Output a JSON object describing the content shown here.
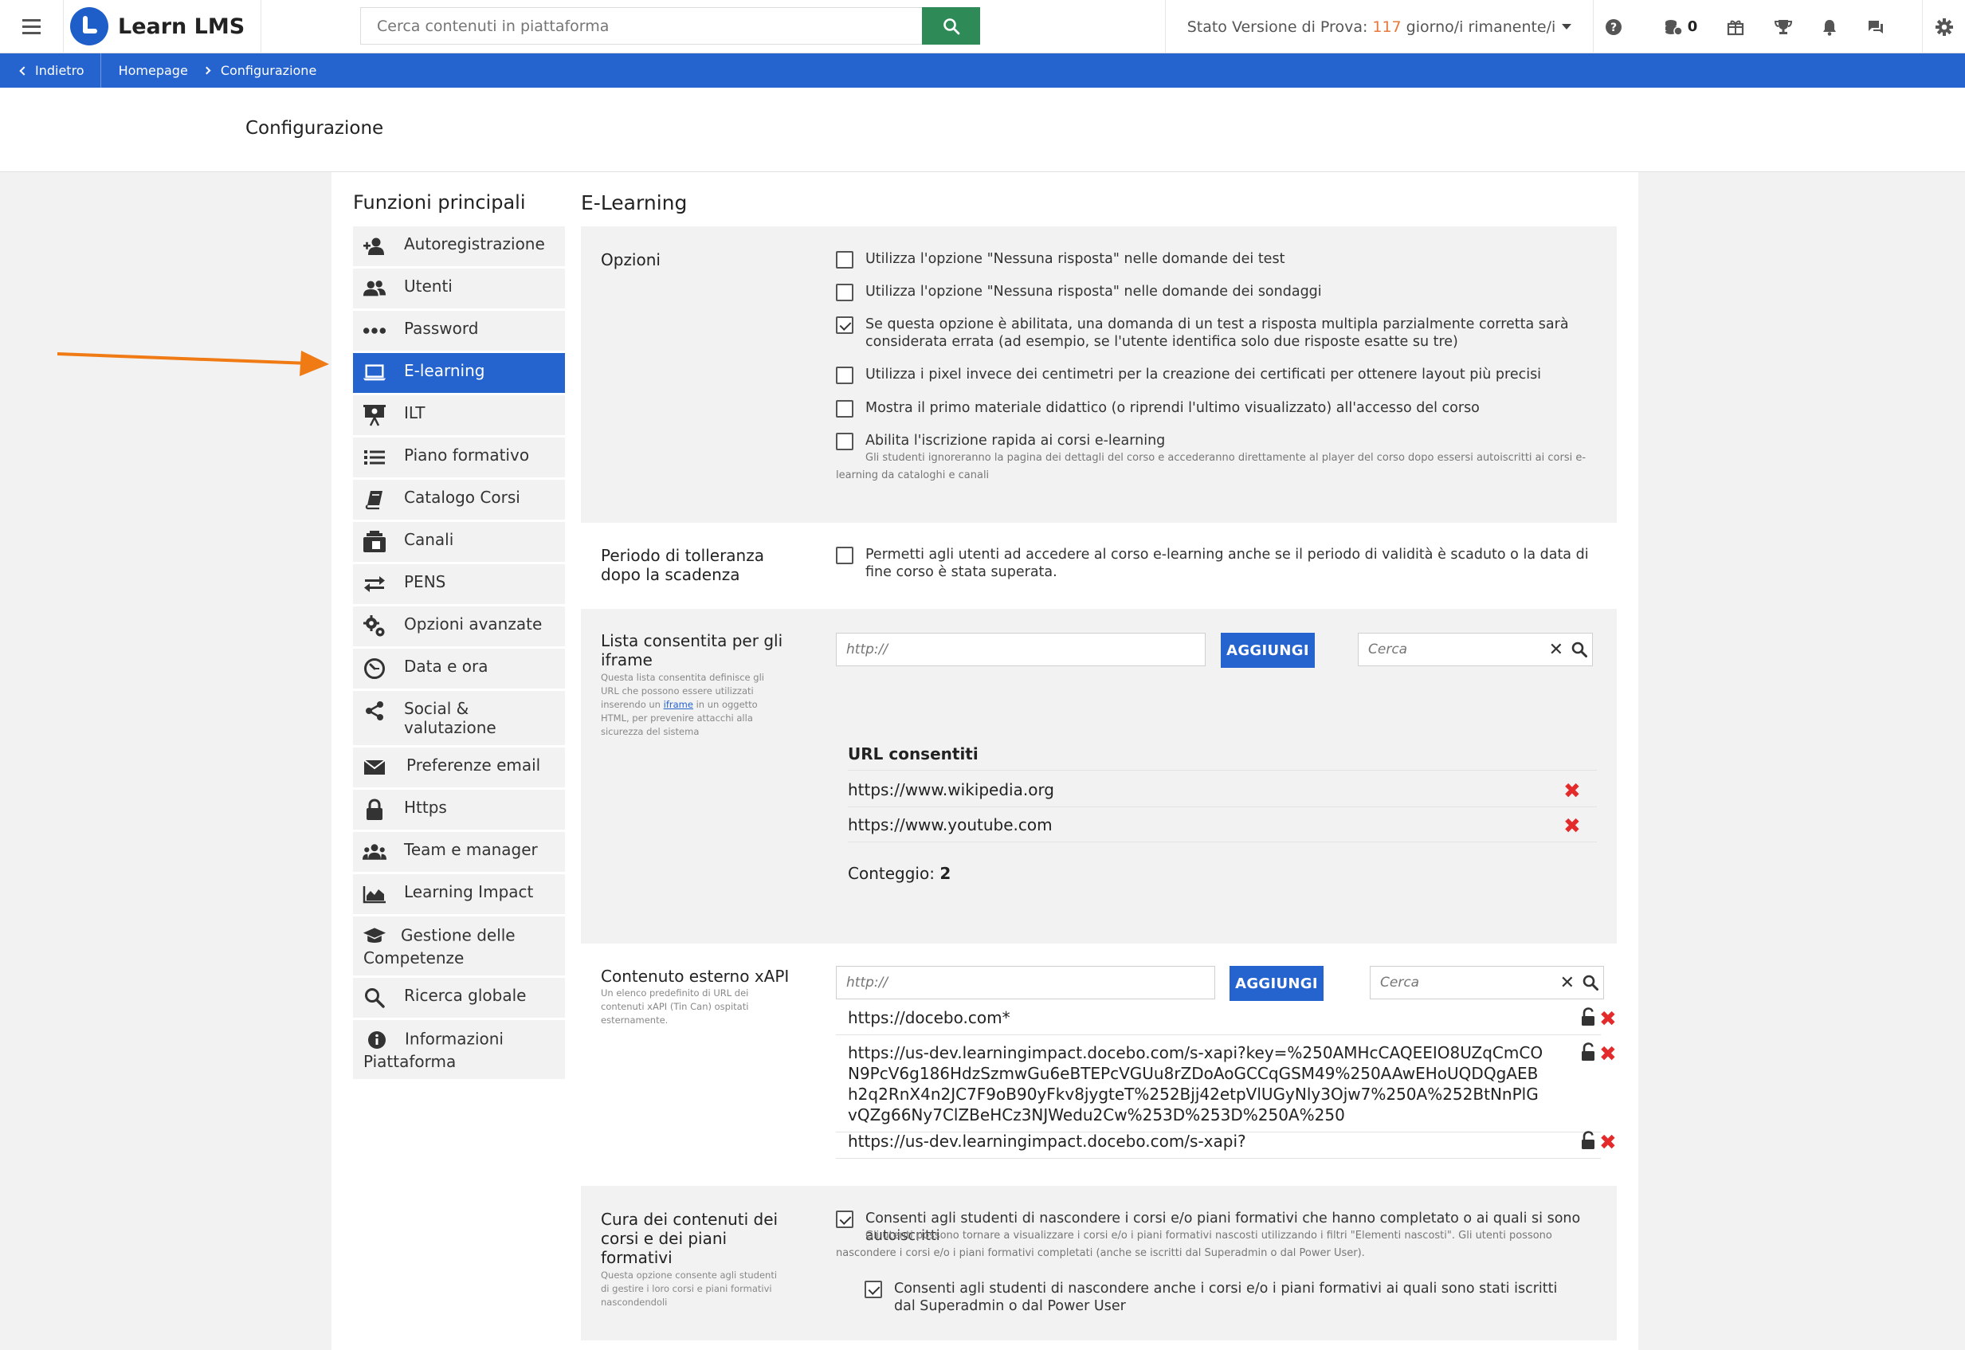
{
  "header": {
    "brand": "Learn LMS",
    "search_placeholder": "Cerca contenuti in piattaforma",
    "trial_prefix": "Stato Versione di Prova:",
    "trial_days": "117",
    "trial_suffix": "giorno/i rimanente/i",
    "credits_count": "0"
  },
  "breadcrumb": {
    "back": "Indietro",
    "home": "Homepage",
    "current": "Configurazione"
  },
  "page": {
    "title": "Configurazione"
  },
  "sidebar": {
    "title": "Funzioni principali",
    "items": [
      {
        "label": "Autoregistrazione",
        "icon": "user-add-icon"
      },
      {
        "label": "Utenti",
        "icon": "users-icon"
      },
      {
        "label": "Password",
        "icon": "dots-icon"
      },
      {
        "label": "E-learning",
        "icon": "laptop-icon",
        "active": true
      },
      {
        "label": "ILT",
        "icon": "presentation-icon"
      },
      {
        "label": "Piano formativo",
        "icon": "list-icon"
      },
      {
        "label": "Catalogo Corsi",
        "icon": "book-icon"
      },
      {
        "label": "Canali",
        "icon": "channels-icon"
      },
      {
        "label": "PENS",
        "icon": "arrows-icon"
      },
      {
        "label": "Opzioni avanzate",
        "icon": "gears-icon"
      },
      {
        "label": "Data e ora",
        "icon": "clock-icon"
      },
      {
        "label": "Social & valutazione",
        "icon": "share-icon"
      },
      {
        "label": "Preferenze email",
        "icon": "envelope-icon"
      },
      {
        "label": "Https",
        "icon": "lock-icon"
      },
      {
        "label": "Team e manager",
        "icon": "team-icon"
      },
      {
        "label": "Learning Impact",
        "icon": "area-chart-icon"
      },
      {
        "label": "Gestione delle Competenze",
        "icon": "graduation-cap-icon"
      },
      {
        "label": "Ricerca globale",
        "icon": "search-icon"
      },
      {
        "label": "Informazioni Piattaforma",
        "icon": "info-icon"
      }
    ]
  },
  "main": {
    "title": "E-Learning",
    "options": {
      "label": "Opzioni",
      "items": [
        {
          "text": "Utilizza l'opzione \"Nessuna risposta\" nelle domande dei test",
          "checked": false
        },
        {
          "text": "Utilizza l'opzione \"Nessuna risposta\" nelle domande dei sondaggi",
          "checked": false
        },
        {
          "text": "Se questa opzione è abilitata, una domanda di un test a risposta multipla parzialmente corretta sarà considerata errata (ad esempio, se l'utente identifica solo due risposte esatte su tre)",
          "checked": true
        },
        {
          "text": "Utilizza i pixel invece dei centimetri per la creazione dei certificati per ottenere layout più precisi",
          "checked": false
        },
        {
          "text": "Mostra il primo materiale didattico (o riprendi l'ultimo visualizzato) all'accesso del corso",
          "checked": false
        },
        {
          "text": "Abilita l'iscrizione rapida ai corsi e-learning",
          "checked": false
        }
      ],
      "note": "Gli studenti ignoreranno la pagina dei dettagli del corso e accederanno direttamente al player del corso dopo essersi autoiscritti ai corsi e-learning da cataloghi e canali"
    },
    "grace": {
      "label": "Periodo di tolleranza dopo la scadenza",
      "option": "Permetti agli utenti ad accedere al corso e-learning anche se il periodo di validità è scaduto o la data di fine corso è stata superata.",
      "checked": false
    },
    "iframe": {
      "label": "Lista consentita per gli iframe",
      "desc_pre": "Questa lista consentita definisce gli URL che possono essere utilizzati inserendo un",
      "desc_link": "iframe",
      "desc_post": "in un oggetto HTML, per prevenire attacchi alla sicurezza del sistema",
      "url_placeholder": "http://",
      "add_label": "AGGIUNGI",
      "search_placeholder": "Cerca",
      "list_header": "URL consentiti",
      "urls": [
        "https://www.wikipedia.org",
        "https://www.youtube.com"
      ],
      "count_label": "Conteggio:",
      "count": "2"
    },
    "xapi": {
      "label": "Contenuto esterno xAPI",
      "desc": "Un elenco predefinito di URL dei contenuti xAPI (Tin Can) ospitati esternamente.",
      "url_placeholder": "http://",
      "add_label": "AGGIUNGI",
      "search_placeholder": "Cerca",
      "urls": [
        "https://docebo.com*",
        "https://us-dev.learningimpact.docebo.com/s-xapi?key=%250AMHcCAQEEIO8UZqCmCON9PcV6g186HdzSzmwGu6eBTEPcVGUu8rZDoAoGCCqGSM49%250AAwEHoUQDQgAEBh2q2RnX4n2JC7F9oB90yFkv8jygteT%252Bjj42etpVlUGyNly3Ojw7%250A%252BtNnPlGvQZg66Ny7ClZBeHCz3NJWedu2Cw%253D%253D%250A%250",
        "https://us-dev.learningimpact.docebo.com/s-xapi?"
      ]
    },
    "curation": {
      "label": "Cura dei contenuti dei corsi e dei piani formativi",
      "desc": "Questa opzione consente agli studenti di gestire i loro corsi e piani formativi nascondendoli",
      "option1": "Consenti agli studenti di nascondere i corsi e/o piani formativi che hanno completato o ai quali si sono autoiscritti",
      "note1": "Gli utenti possono tornare a visualizzare i corsi e/o i piani formativi nascosti utilizzando i filtri \"Elementi nascosti\". Gli utenti possono nascondere i corsi e/o i piani formativi completati (anche se iscritti dal Superadmin o dal Power User).",
      "option2": "Consenti agli studenti di nascondere anche i corsi e/o i piani formativi ai quali sono stati iscritti dal Superadmin o dal Power User",
      "checked1": true,
      "checked2": true
    }
  },
  "colors": {
    "primary": "#2563cf",
    "search_green": "#2e8b57",
    "trial_days": "#e8773a",
    "delete_red": "#e32b2b",
    "arrow_orange": "#f07a14"
  }
}
